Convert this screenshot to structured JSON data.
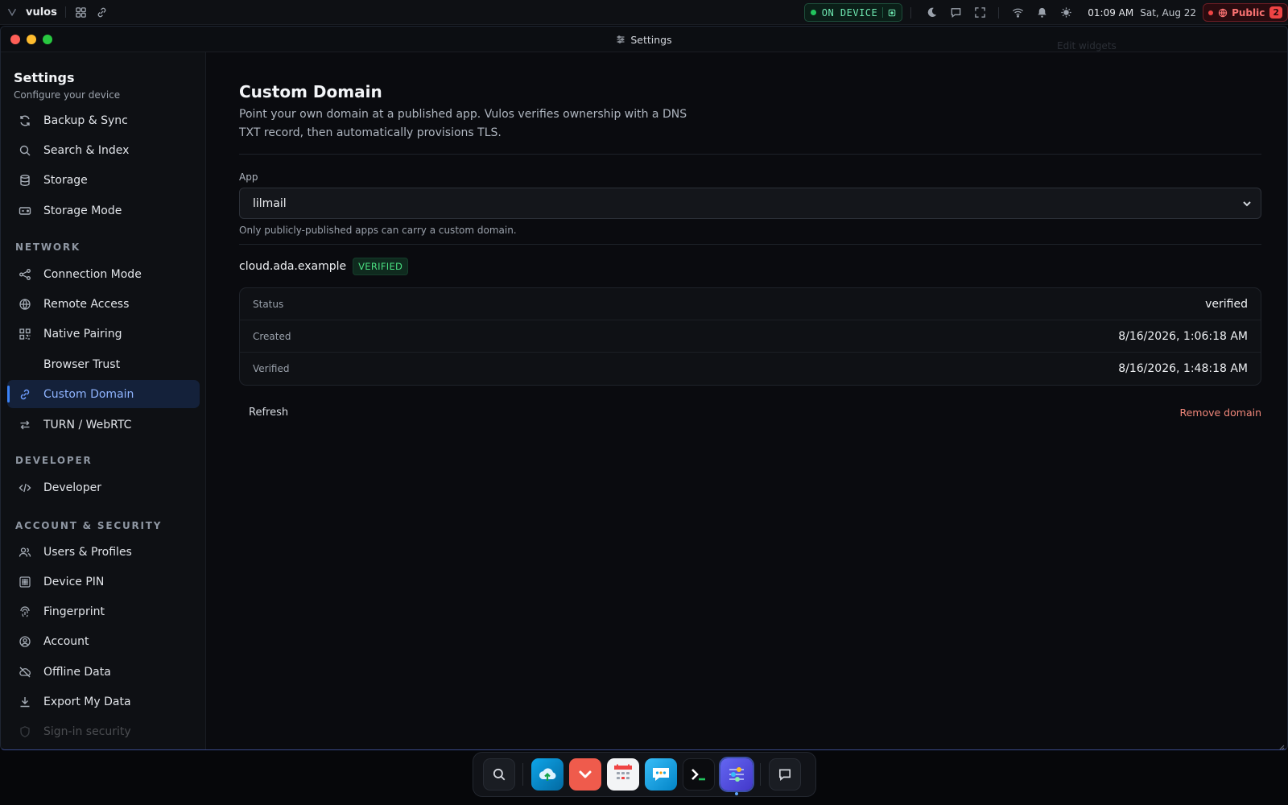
{
  "topbar": {
    "brand": "vulos",
    "device_status": "ON DEVICE",
    "time": "01:09 AM",
    "date": "Sat, Aug 22",
    "public_label": "Public",
    "public_count": "2"
  },
  "window": {
    "title": "Settings",
    "ghost_text": "Edit widgets"
  },
  "sidebar": {
    "title": "Settings",
    "subtitle": "Configure your device",
    "items_top": [
      {
        "label": "Backup & Sync",
        "icon": "refresh-icon"
      },
      {
        "label": "Search & Index",
        "icon": "search-icon"
      },
      {
        "label": "Storage",
        "icon": "database-icon"
      },
      {
        "label": "Storage Mode",
        "icon": "drive-icon"
      }
    ],
    "network_heading": "NETWORK",
    "items_network": [
      {
        "label": "Connection Mode",
        "icon": "share-nodes-icon"
      },
      {
        "label": "Remote Access",
        "icon": "globe-icon"
      },
      {
        "label": "Native Pairing",
        "icon": "qr-code-icon"
      },
      {
        "label": "Browser Trust",
        "icon": ""
      },
      {
        "label": "Custom Domain",
        "icon": "link-icon"
      },
      {
        "label": "TURN / WebRTC",
        "icon": "swap-arrows-icon"
      }
    ],
    "developer_heading": "DEVELOPER",
    "items_developer": [
      {
        "label": "Developer",
        "icon": "code-icon"
      }
    ],
    "account_heading": "ACCOUNT & SECURITY",
    "items_account": [
      {
        "label": "Users & Profiles",
        "icon": "users-icon"
      },
      {
        "label": "Device PIN",
        "icon": "keypad-icon"
      },
      {
        "label": "Fingerprint",
        "icon": "fingerprint-icon"
      },
      {
        "label": "Account",
        "icon": "user-circle-icon"
      },
      {
        "label": "Offline Data",
        "icon": "cloud-off-icon"
      },
      {
        "label": "Export My Data",
        "icon": "download-icon"
      },
      {
        "label": "Sign-in security",
        "icon": "shield-icon"
      }
    ]
  },
  "main": {
    "title": "Custom Domain",
    "description": "Point your own domain at a published app. Vulos verifies ownership with a DNS TXT record, then automatically provisions TLS.",
    "app_label": "App",
    "app_value": "lilmail",
    "app_hint": "Only publicly-published apps can carry a custom domain.",
    "domain": "cloud.ada.example",
    "domain_badge": "VERIFIED",
    "details": [
      {
        "key": "Status",
        "value": "verified"
      },
      {
        "key": "Created",
        "value": "8/16/2026, 1:06:18 AM"
      },
      {
        "key": "Verified",
        "value": "8/16/2026, 1:48:18 AM"
      }
    ],
    "refresh_label": "Refresh",
    "remove_label": "Remove domain"
  },
  "dock": {
    "apps": [
      "search-icon",
      "cloud-upload-icon",
      "pocket-icon",
      "calendar-icon",
      "chat-icon",
      "terminal-icon",
      "settings-icon",
      "message-icon"
    ]
  },
  "colors": {
    "accent": "#3b82f6",
    "success": "#4ade80",
    "danger": "#f0877a",
    "background": "#0a0b0f"
  }
}
